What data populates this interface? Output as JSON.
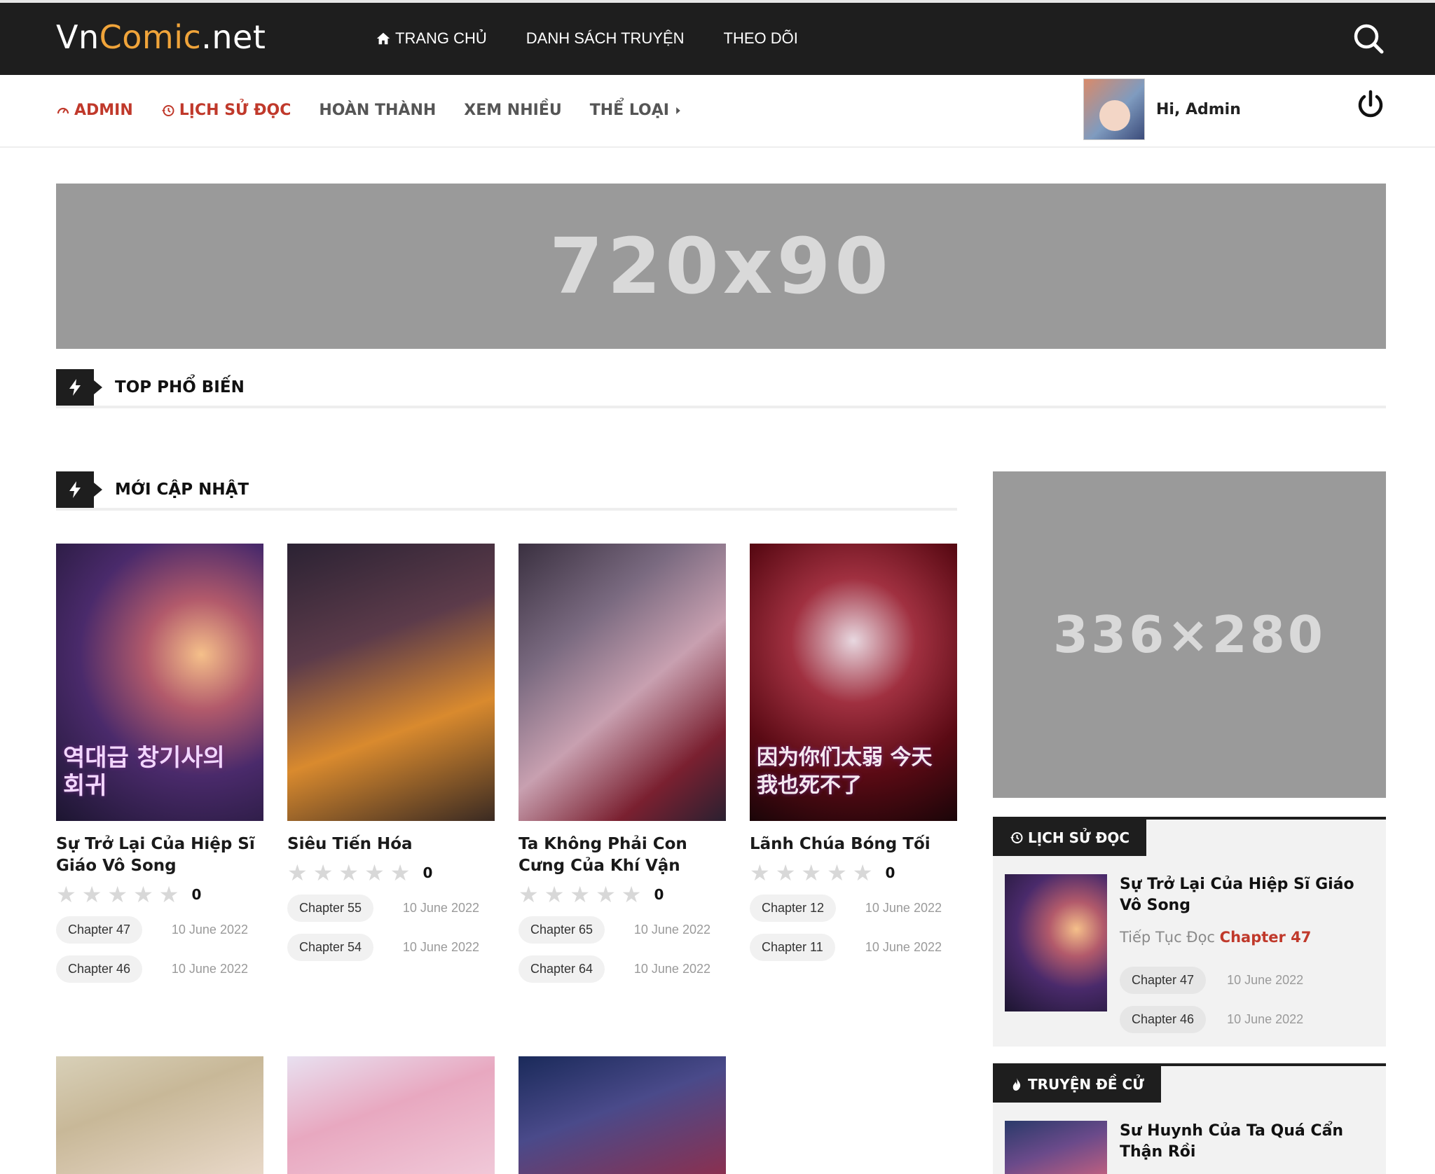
{
  "header": {
    "logo_main": "Vn",
    "logo_accent": "Comic",
    "logo_suffix": ".net",
    "nav": [
      {
        "label": "TRANG CHỦ",
        "icon": "home-icon"
      },
      {
        "label": "DANH SÁCH TRUYỆN"
      },
      {
        "label": "THEO DÕI"
      }
    ],
    "search_icon": "search-icon"
  },
  "subnav": {
    "items": [
      {
        "label": "ADMIN",
        "icon": "dashboard-icon"
      },
      {
        "label": "LỊCH SỬ ĐỌC",
        "icon": "history-icon"
      },
      {
        "label": "HOÀN THÀNH"
      },
      {
        "label": "XEM NHIỀU"
      },
      {
        "label": "THỂ LOẠI",
        "icon": "caret-right-icon"
      }
    ],
    "greeting": "Hi, Admin",
    "power_icon": "power-icon"
  },
  "ads": {
    "top": "720x90",
    "side": "336×280"
  },
  "sections": {
    "popular": "TOP PHỔ BIẾN",
    "latest": "MỚI CẬP NHẬT"
  },
  "comics": [
    {
      "title": "Sự Trở Lại Của Hiệp Sĩ Giáo Vô Song",
      "cover_text": "역대급 창기사의 회귀",
      "score": "0",
      "chapters": [
        {
          "label": "Chapter 47",
          "date": "10 June 2022"
        },
        {
          "label": "Chapter 46",
          "date": "10 June 2022"
        }
      ]
    },
    {
      "title": "Siêu Tiến Hóa",
      "cover_text": "",
      "score": "0",
      "chapters": [
        {
          "label": "Chapter 55",
          "date": "10 June 2022"
        },
        {
          "label": "Chapter 54",
          "date": "10 June 2022"
        }
      ]
    },
    {
      "title": "Ta Không Phải Con Cưng Của Khí Vận",
      "cover_text": "",
      "score": "0",
      "chapters": [
        {
          "label": "Chapter 65",
          "date": "10 June 2022"
        },
        {
          "label": "Chapter 64",
          "date": "10 June 2022"
        }
      ]
    },
    {
      "title": "Lãnh Chúa Bóng Tối",
      "cover_text": "因为你们太弱 今天我也死不了",
      "score": "0",
      "chapters": [
        {
          "label": "Chapter 12",
          "date": "10 June 2022"
        },
        {
          "label": "Chapter 11",
          "date": "10 June 2022"
        }
      ]
    }
  ],
  "sidebar": {
    "history": {
      "tab": "LỊCH SỬ ĐỌC",
      "item_title": "Sự Trở Lại Của Hiệp Sĩ Giáo Vô Song",
      "continue_prefix": "Tiếp Tục Đọc",
      "continue_chapter": "Chapter 47",
      "chapters": [
        {
          "label": "Chapter 47",
          "date": "10 June 2022"
        },
        {
          "label": "Chapter 46",
          "date": "10 June 2022"
        }
      ]
    },
    "recommended": {
      "tab": "TRUYỆN ĐỀ CỬ",
      "item_title": "Sư Huynh Của Ta Quá Cẩn Thận Rồi"
    }
  },
  "colors": {
    "topbar": "#1e1e1e",
    "accent_red": "#c0392b",
    "logo_accent": "#f0a43a",
    "ad_gray": "#9a9a9a"
  }
}
